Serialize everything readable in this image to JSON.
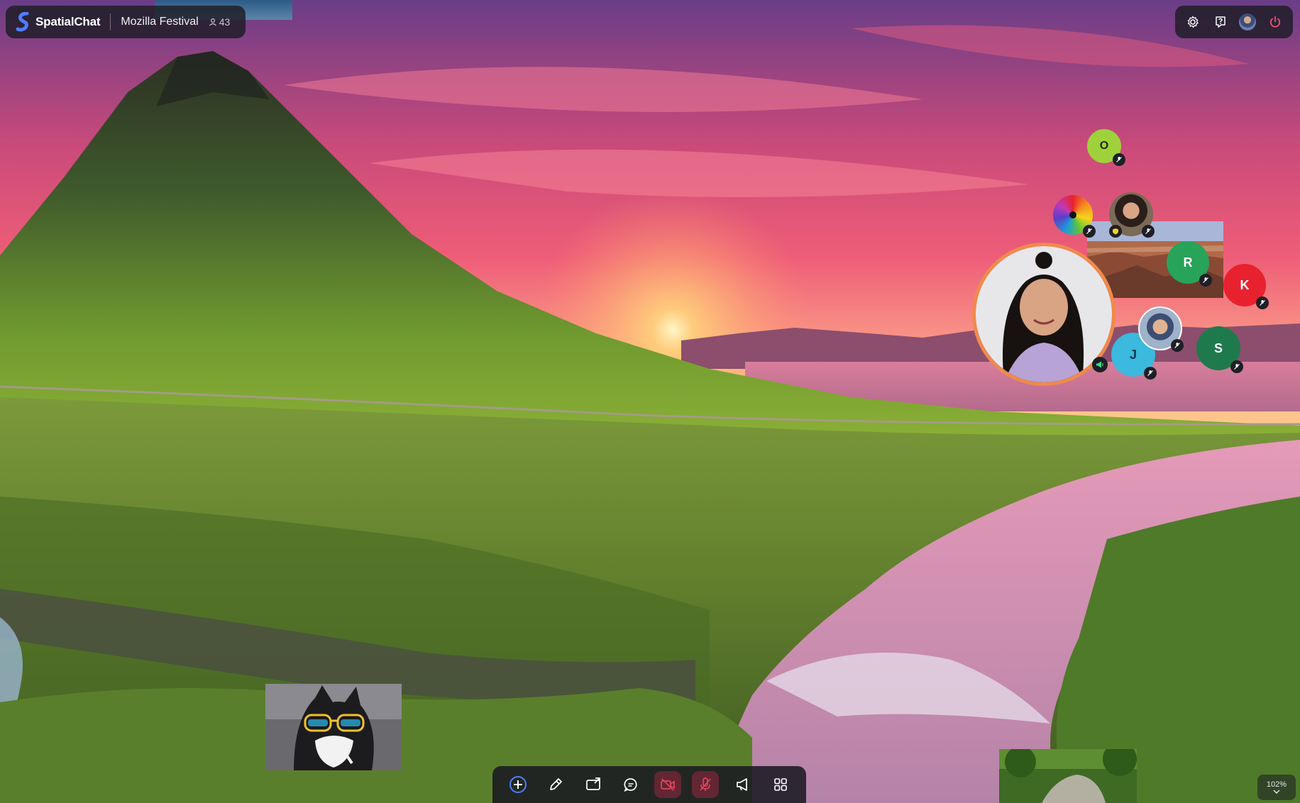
{
  "app": {
    "brand": "SpatialChat",
    "room_name": "Mozilla Festival",
    "participant_count": "43"
  },
  "top_right_controls": [
    {
      "name": "settings",
      "icon": "gear-icon"
    },
    {
      "name": "help",
      "icon": "question-icon"
    },
    {
      "name": "profile",
      "icon": "avatar"
    },
    {
      "name": "leave",
      "icon": "power-icon"
    }
  ],
  "participants": [
    {
      "initial": "O",
      "color": "#9fd23a",
      "muted": true
    },
    {
      "initial": "",
      "color": "rainbow",
      "muted": true
    },
    {
      "initial": "",
      "color": "photo",
      "muted": true
    },
    {
      "initial": "R",
      "color": "#27a35a",
      "muted": true
    },
    {
      "initial": "K",
      "color": "#e8212e",
      "muted": true
    },
    {
      "initial": "J",
      "color": "#3bb9de",
      "muted": true
    },
    {
      "initial": "S",
      "color": "#1e7a4c",
      "muted": true
    },
    {
      "initial": "",
      "color": "photo",
      "muted": true
    },
    {
      "initial": "",
      "color": "video",
      "speaking": true
    }
  ],
  "toolbar": [
    {
      "name": "add",
      "icon": "plus-circle-icon"
    },
    {
      "name": "draw",
      "icon": "pencil-icon"
    },
    {
      "name": "share-screen",
      "icon": "screen-share-icon"
    },
    {
      "name": "chat",
      "icon": "chat-icon"
    },
    {
      "name": "camera",
      "icon": "camera-off-icon",
      "state": "off"
    },
    {
      "name": "microphone",
      "icon": "mic-off-icon",
      "state": "off"
    },
    {
      "name": "broadcast",
      "icon": "megaphone-icon"
    },
    {
      "name": "apps",
      "icon": "grid-icon"
    }
  ],
  "zoom_level": "102%",
  "colors": {
    "speaker_ring": "#f08a4b",
    "accent": "#4f7dff",
    "muted_red": "#e0455f"
  }
}
